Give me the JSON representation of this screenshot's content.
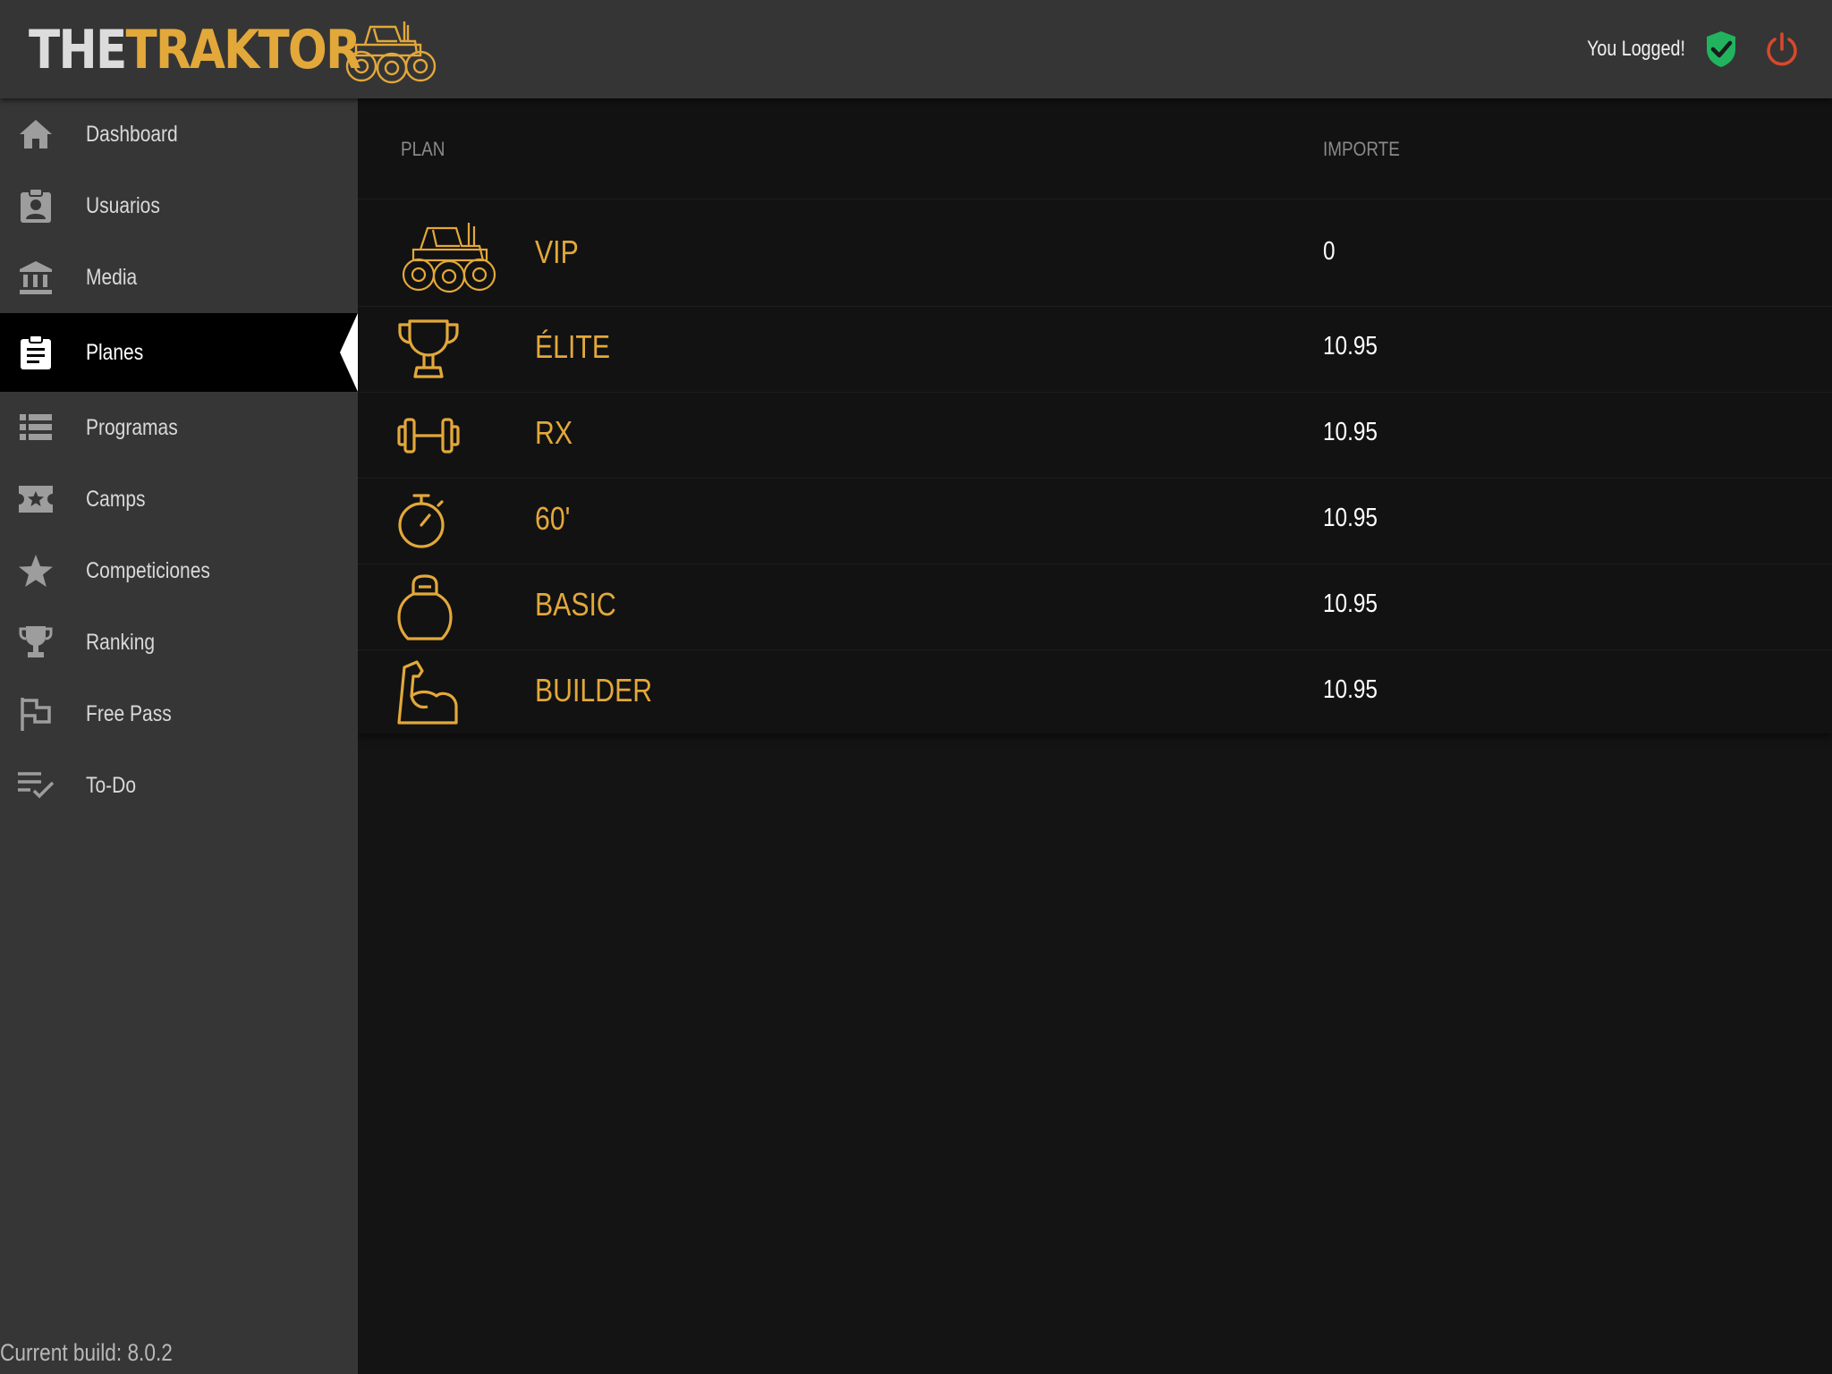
{
  "header": {
    "logo_the": "THE",
    "logo_traktor": "TRAKTOR",
    "status_text": "You Logged!",
    "colors": {
      "accent": "#e3a83a",
      "ok": "#22b35e",
      "power": "#d9482b"
    }
  },
  "sidebar": {
    "items": [
      {
        "label": "Dashboard",
        "icon": "home-icon"
      },
      {
        "label": "Usuarios",
        "icon": "user-badge-icon"
      },
      {
        "label": "Media",
        "icon": "bank-icon"
      },
      {
        "label": "Planes",
        "icon": "clipboard-icon",
        "active": true
      },
      {
        "label": "Programas",
        "icon": "list-icon"
      },
      {
        "label": "Camps",
        "icon": "ticket-star-icon"
      },
      {
        "label": "Competiciones",
        "icon": "star-icon"
      },
      {
        "label": "Ranking",
        "icon": "trophy-icon"
      },
      {
        "label": "Free Pass",
        "icon": "flag-icon"
      },
      {
        "label": "To-Do",
        "icon": "checklist-icon"
      }
    ],
    "build": "Current build: 8.0.2"
  },
  "table": {
    "headers": {
      "plan": "PLAN",
      "amount": "IMPORTE"
    },
    "rows": [
      {
        "icon": "tractor-icon",
        "name": "VIP",
        "amount": "0"
      },
      {
        "icon": "trophy-cup-icon",
        "name": "ÉLITE",
        "amount": "10.95"
      },
      {
        "icon": "dumbbell-icon",
        "name": "RX",
        "amount": "10.95"
      },
      {
        "icon": "stopwatch-icon",
        "name": "60'",
        "amount": "10.95"
      },
      {
        "icon": "kettlebell-icon",
        "name": "BASIC",
        "amount": "10.95"
      },
      {
        "icon": "flexed-arm-icon",
        "name": "BUILDER",
        "amount": "10.95"
      }
    ]
  }
}
